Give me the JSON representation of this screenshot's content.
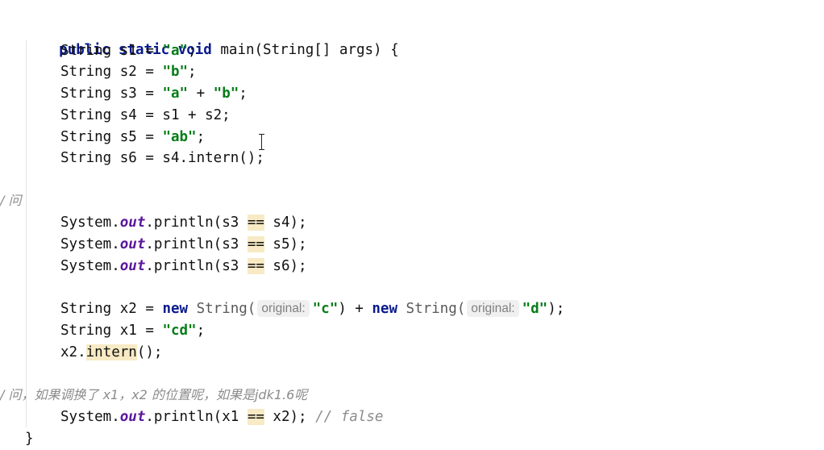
{
  "code": {
    "l1": {
      "kw1": "public",
      "kw2": "static",
      "kw3": "void",
      "rest": " main(String[] args) {"
    },
    "l2": {
      "pre": "String s1 = ",
      "s": "\"a\"",
      "post": ";"
    },
    "l3": {
      "pre": "String s2 = ",
      "s": "\"b\"",
      "post": ";"
    },
    "l4": {
      "pre": "String s3 = ",
      "s1": "\"a\"",
      "mid": " + ",
      "s2": "\"b\"",
      "post": ";"
    },
    "l5": {
      "text": "String s4 = s1 + s2;"
    },
    "l6": {
      "pre": "String s5 = ",
      "s": "\"ab\"",
      "post": ";"
    },
    "l7": {
      "text": "String s6 = s4.intern();"
    },
    "c1": {
      "text": "/ 问"
    },
    "p1": {
      "pre": "System.",
      "out": "out",
      "mid": ".println(s3 ",
      "op": "==",
      "post": " s4);"
    },
    "p2": {
      "pre": "System.",
      "out": "out",
      "mid": ".println(s3 ",
      "op": "==",
      "post": " s5);"
    },
    "p3": {
      "pre": "System.",
      "out": "out",
      "mid": ".println(s3 ",
      "op": "==",
      "post": " s6);"
    },
    "x2": {
      "pre": "String x2 = ",
      "new1": "new",
      "type1": " String(",
      "hint1": "original:",
      "s1": "\"c\"",
      "mid": ") + ",
      "new2": "new",
      "type2": " String(",
      "hint2": "original:",
      "s2": "\"d\"",
      "post": ");"
    },
    "x1": {
      "pre": "String x1 = ",
      "s": "\"cd\"",
      "post": ";"
    },
    "xi": {
      "pre": "x2.",
      "method": "intern",
      "post": "();"
    },
    "c2": {
      "text": "/ 问，如果调换了 x1，x2 的位置呢，如果是jdk1.6呢"
    },
    "p4": {
      "pre": "System.",
      "out": "out",
      "mid": ".println(x1 ",
      "op": "==",
      "post": " x2); ",
      "cmt": "// false"
    },
    "close": {
      "text": "}"
    }
  }
}
